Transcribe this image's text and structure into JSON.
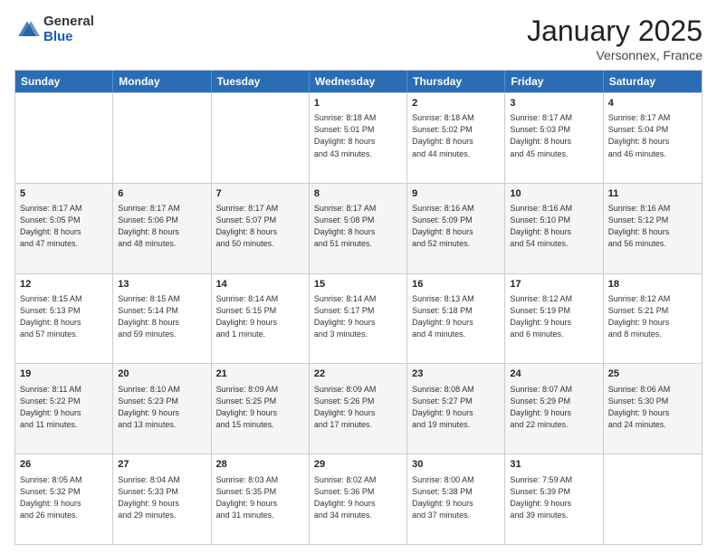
{
  "header": {
    "logo_general": "General",
    "logo_blue": "Blue",
    "month_title": "January 2025",
    "location": "Versonnex, France"
  },
  "weekdays": [
    "Sunday",
    "Monday",
    "Tuesday",
    "Wednesday",
    "Thursday",
    "Friday",
    "Saturday"
  ],
  "weeks": [
    [
      {
        "day": "",
        "info": ""
      },
      {
        "day": "",
        "info": ""
      },
      {
        "day": "",
        "info": ""
      },
      {
        "day": "1",
        "info": "Sunrise: 8:18 AM\nSunset: 5:01 PM\nDaylight: 8 hours\nand 43 minutes."
      },
      {
        "day": "2",
        "info": "Sunrise: 8:18 AM\nSunset: 5:02 PM\nDaylight: 8 hours\nand 44 minutes."
      },
      {
        "day": "3",
        "info": "Sunrise: 8:17 AM\nSunset: 5:03 PM\nDaylight: 8 hours\nand 45 minutes."
      },
      {
        "day": "4",
        "info": "Sunrise: 8:17 AM\nSunset: 5:04 PM\nDaylight: 8 hours\nand 46 minutes."
      }
    ],
    [
      {
        "day": "5",
        "info": "Sunrise: 8:17 AM\nSunset: 5:05 PM\nDaylight: 8 hours\nand 47 minutes."
      },
      {
        "day": "6",
        "info": "Sunrise: 8:17 AM\nSunset: 5:06 PM\nDaylight: 8 hours\nand 48 minutes."
      },
      {
        "day": "7",
        "info": "Sunrise: 8:17 AM\nSunset: 5:07 PM\nDaylight: 8 hours\nand 50 minutes."
      },
      {
        "day": "8",
        "info": "Sunrise: 8:17 AM\nSunset: 5:08 PM\nDaylight: 8 hours\nand 51 minutes."
      },
      {
        "day": "9",
        "info": "Sunrise: 8:16 AM\nSunset: 5:09 PM\nDaylight: 8 hours\nand 52 minutes."
      },
      {
        "day": "10",
        "info": "Sunrise: 8:16 AM\nSunset: 5:10 PM\nDaylight: 8 hours\nand 54 minutes."
      },
      {
        "day": "11",
        "info": "Sunrise: 8:16 AM\nSunset: 5:12 PM\nDaylight: 8 hours\nand 56 minutes."
      }
    ],
    [
      {
        "day": "12",
        "info": "Sunrise: 8:15 AM\nSunset: 5:13 PM\nDaylight: 8 hours\nand 57 minutes."
      },
      {
        "day": "13",
        "info": "Sunrise: 8:15 AM\nSunset: 5:14 PM\nDaylight: 8 hours\nand 59 minutes."
      },
      {
        "day": "14",
        "info": "Sunrise: 8:14 AM\nSunset: 5:15 PM\nDaylight: 9 hours\nand 1 minute."
      },
      {
        "day": "15",
        "info": "Sunrise: 8:14 AM\nSunset: 5:17 PM\nDaylight: 9 hours\nand 3 minutes."
      },
      {
        "day": "16",
        "info": "Sunrise: 8:13 AM\nSunset: 5:18 PM\nDaylight: 9 hours\nand 4 minutes."
      },
      {
        "day": "17",
        "info": "Sunrise: 8:12 AM\nSunset: 5:19 PM\nDaylight: 9 hours\nand 6 minutes."
      },
      {
        "day": "18",
        "info": "Sunrise: 8:12 AM\nSunset: 5:21 PM\nDaylight: 9 hours\nand 8 minutes."
      }
    ],
    [
      {
        "day": "19",
        "info": "Sunrise: 8:11 AM\nSunset: 5:22 PM\nDaylight: 9 hours\nand 11 minutes."
      },
      {
        "day": "20",
        "info": "Sunrise: 8:10 AM\nSunset: 5:23 PM\nDaylight: 9 hours\nand 13 minutes."
      },
      {
        "day": "21",
        "info": "Sunrise: 8:09 AM\nSunset: 5:25 PM\nDaylight: 9 hours\nand 15 minutes."
      },
      {
        "day": "22",
        "info": "Sunrise: 8:09 AM\nSunset: 5:26 PM\nDaylight: 9 hours\nand 17 minutes."
      },
      {
        "day": "23",
        "info": "Sunrise: 8:08 AM\nSunset: 5:27 PM\nDaylight: 9 hours\nand 19 minutes."
      },
      {
        "day": "24",
        "info": "Sunrise: 8:07 AM\nSunset: 5:29 PM\nDaylight: 9 hours\nand 22 minutes."
      },
      {
        "day": "25",
        "info": "Sunrise: 8:06 AM\nSunset: 5:30 PM\nDaylight: 9 hours\nand 24 minutes."
      }
    ],
    [
      {
        "day": "26",
        "info": "Sunrise: 8:05 AM\nSunset: 5:32 PM\nDaylight: 9 hours\nand 26 minutes."
      },
      {
        "day": "27",
        "info": "Sunrise: 8:04 AM\nSunset: 5:33 PM\nDaylight: 9 hours\nand 29 minutes."
      },
      {
        "day": "28",
        "info": "Sunrise: 8:03 AM\nSunset: 5:35 PM\nDaylight: 9 hours\nand 31 minutes."
      },
      {
        "day": "29",
        "info": "Sunrise: 8:02 AM\nSunset: 5:36 PM\nDaylight: 9 hours\nand 34 minutes."
      },
      {
        "day": "30",
        "info": "Sunrise: 8:00 AM\nSunset: 5:38 PM\nDaylight: 9 hours\nand 37 minutes."
      },
      {
        "day": "31",
        "info": "Sunrise: 7:59 AM\nSunset: 5:39 PM\nDaylight: 9 hours\nand 39 minutes."
      },
      {
        "day": "",
        "info": ""
      }
    ]
  ]
}
